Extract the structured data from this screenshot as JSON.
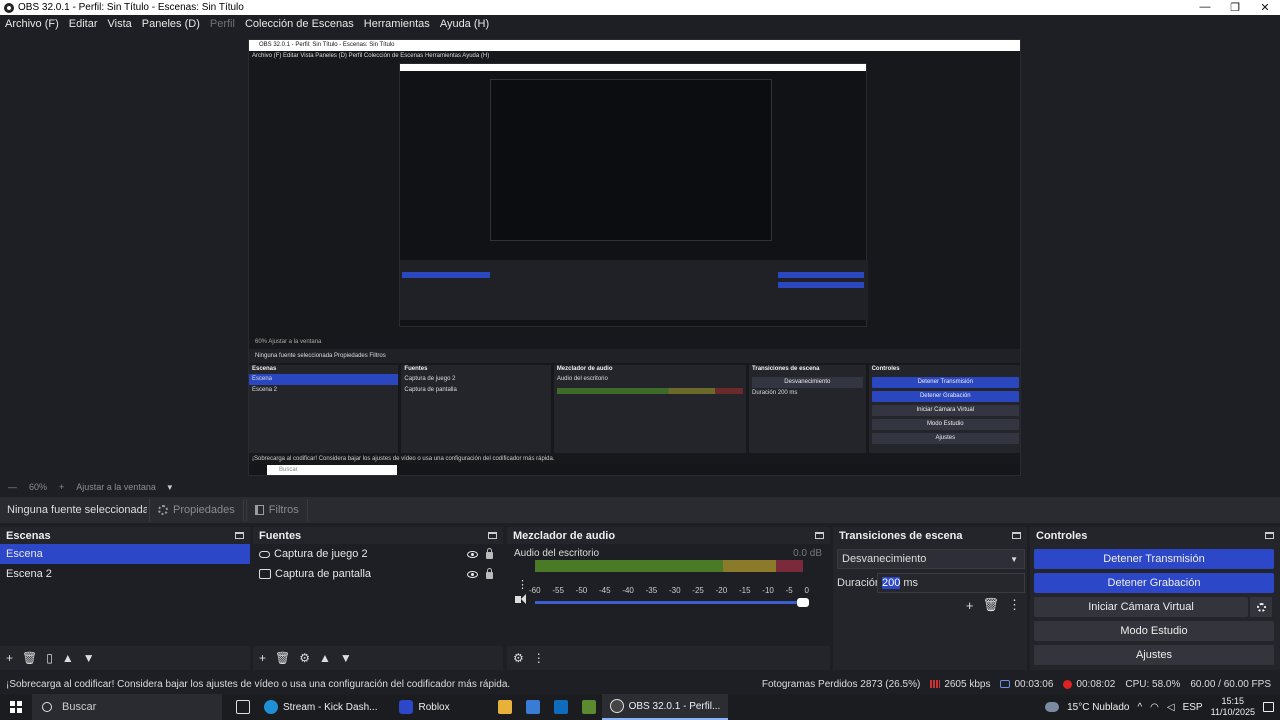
{
  "window": {
    "title": "OBS 32.0.1 - Perfil: Sin Título - Escenas: Sin Título"
  },
  "menu": [
    {
      "label": "Archivo (F)",
      "disabled": false
    },
    {
      "label": "Editar",
      "disabled": false
    },
    {
      "label": "Vista",
      "disabled": false
    },
    {
      "label": "Paneles (D)",
      "disabled": false
    },
    {
      "label": "Perfil",
      "disabled": true
    },
    {
      "label": "Colección de Escenas",
      "disabled": false
    },
    {
      "label": "Herramientas",
      "disabled": false
    },
    {
      "label": "Ayuda (H)",
      "disabled": false
    }
  ],
  "preview": {
    "nested_title": "OBS 32.0.1 - Perfil: Sin Título - Escenas: Sin Título",
    "nested_menu": "Archivo (F)  Editar  Vista  Paneles (D)  Perfil  Colección de Escenas  Herramientas  Ayuda (H)",
    "nested_zoom": "60%    Ajustar a la ventana",
    "nested_props": "Ninguna fuente seleccionada      Propiedades      Filtros",
    "nested_scenes_header": "Escenas",
    "nested_scenes": [
      "Escena",
      "Escena 2"
    ],
    "nested_sources_header": "Fuentes",
    "nested_sources": [
      "Captura de juego 2",
      "Captura de pantalla"
    ],
    "nested_mixer_header": "Mezclador de audio",
    "nested_mixer_label": "Audio del escritorio",
    "nested_trans_header": "Transiciones de escena",
    "nested_trans_select": "Desvanecimiento",
    "nested_duration": "Duración  200 ms",
    "nested_controls_header": "Controles",
    "nested_controls": [
      "Detener Transmisión",
      "Detener Grabación",
      "Iniciar Cámara Virtual",
      "Modo Estudio",
      "Ajustes"
    ],
    "nested_status": "¡Sobrecarga al codificar! Considera bajar los ajustes de vídeo o usa una configuración del codificador más rápida.",
    "nested_search": "Buscar"
  },
  "zoom": {
    "level": "60%",
    "fit": "Ajustar a la ventana"
  },
  "properties_bar": {
    "no_selection": "Ninguna fuente seleccionada",
    "properties": "Propiedades",
    "filters": "Filtros"
  },
  "scenes": {
    "header": "Escenas",
    "items": [
      "Escena",
      "Escena 2"
    ],
    "selected": 0
  },
  "sources": {
    "header": "Fuentes",
    "items": [
      {
        "label": "Captura de juego 2",
        "icon": "gamepad-icon"
      },
      {
        "label": "Captura de pantalla",
        "icon": "monitor-icon"
      }
    ]
  },
  "mixer": {
    "header": "Mezclador de audio",
    "channel": "Audio del escritorio",
    "db": "0.0 dB",
    "scale": [
      "-60",
      "-55",
      "-50",
      "-45",
      "-40",
      "-35",
      "-30",
      "-25",
      "-20",
      "-15",
      "-10",
      "-5",
      "0"
    ],
    "volume_level": 1.0
  },
  "transitions": {
    "header": "Transiciones de escena",
    "selected": "Desvanecimiento",
    "duration_label": "Duración",
    "duration_value": "200",
    "duration_unit": "ms"
  },
  "controls": {
    "header": "Controles",
    "stop_stream": "Detener Transmisión",
    "stop_record": "Detener Grabación",
    "virtual_cam": "Iniciar Cámara Virtual",
    "studio_mode": "Modo Estudio",
    "settings": "Ajustes"
  },
  "status": {
    "message": "¡Sobrecarga al codificar! Considera bajar los ajustes de vídeo o usa una configuración del codificador más rápida.",
    "dropped_frames": "Fotogramas Perdidos 2873 (26.5%)",
    "bitrate": "2605 kbps",
    "stream_time": "00:03:06",
    "rec_time": "00:08:02",
    "cpu": "CPU: 58.0%",
    "fps": "60.00 / 60.00 FPS"
  },
  "taskbar": {
    "search": "Buscar",
    "apps": [
      {
        "label": "Stream - Kick Dash...",
        "color": "#1f8fd6"
      },
      {
        "label": "Roblox",
        "color": "#2c48c8"
      },
      {
        "label": "OBS 32.0.1 - Perfil...",
        "color": "#444"
      }
    ],
    "weather": "15°C  Nublado",
    "lang": "ESP",
    "time": "15:15",
    "date": "11/10/2025"
  },
  "colors": {
    "accent": "#2c48c8",
    "panel": "#24252b",
    "background": "#1e1f24"
  }
}
